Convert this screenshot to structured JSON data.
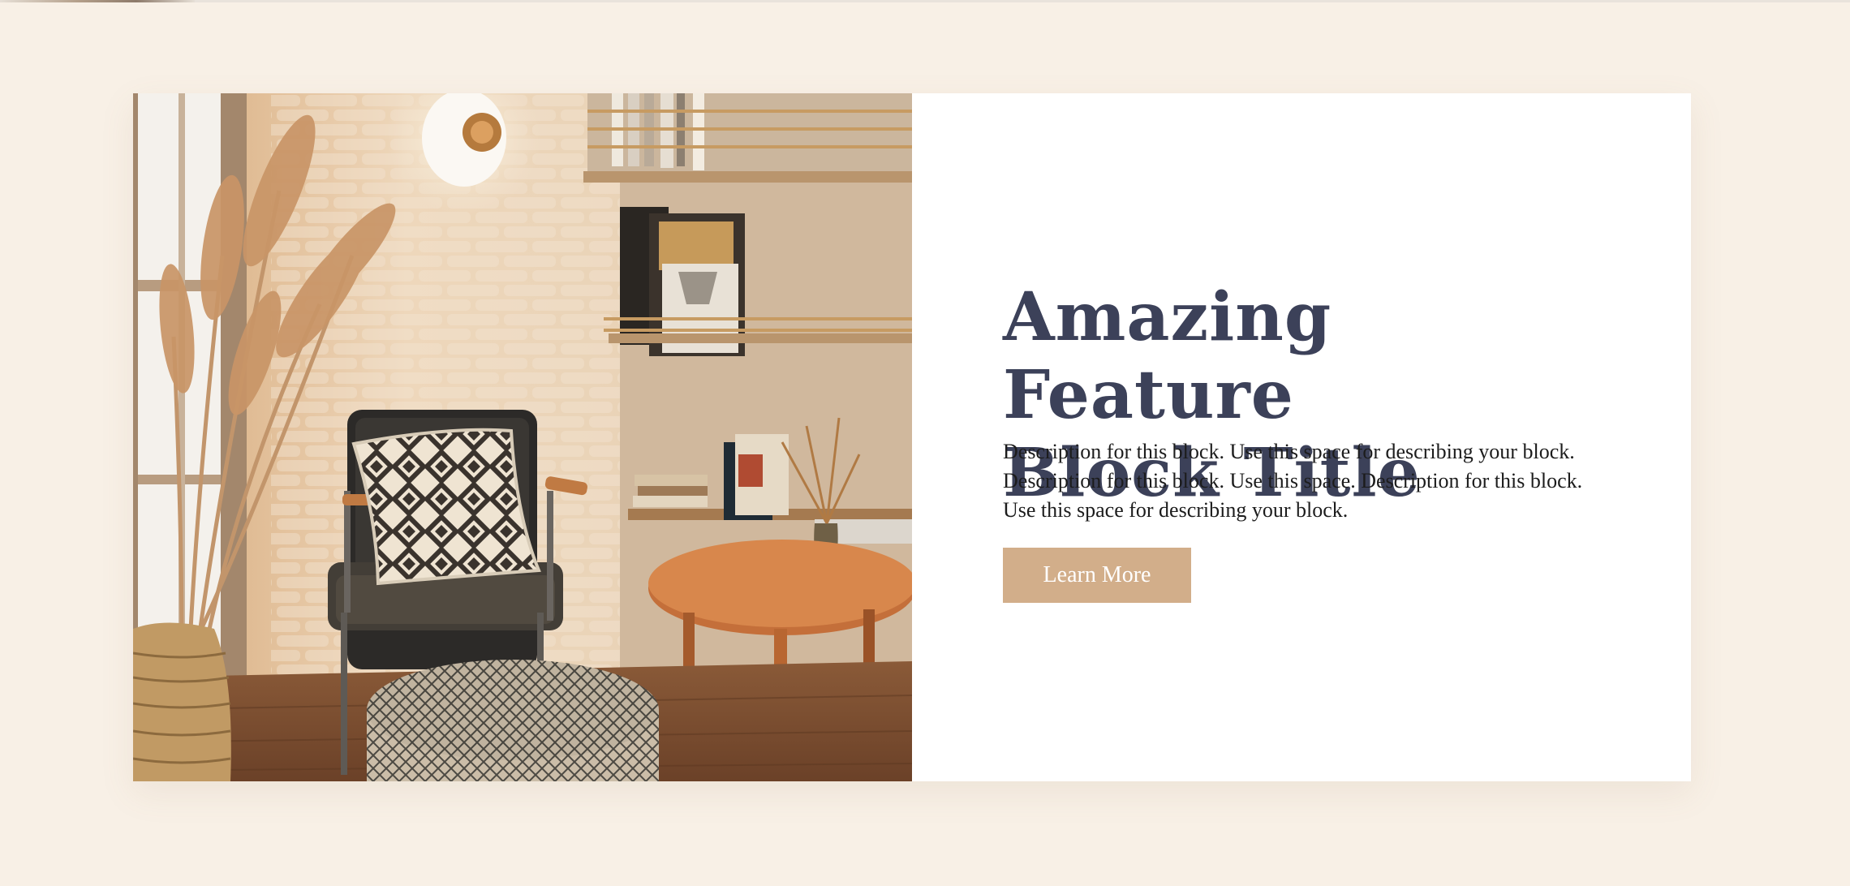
{
  "feature": {
    "title_line1": "Amazing Feature",
    "title_line2": "Block Title",
    "description": "Description for this block. Use this space for describing your block. Description for this block. Use this space. Description for this block. Use this space for describing your block.",
    "button_label": "Learn More"
  },
  "colors": {
    "page_background": "#f8f0e6",
    "card_background": "#ffffff",
    "title_color": "#3c4159",
    "button_background": "#d2ae8a",
    "button_text": "#ffffff"
  }
}
